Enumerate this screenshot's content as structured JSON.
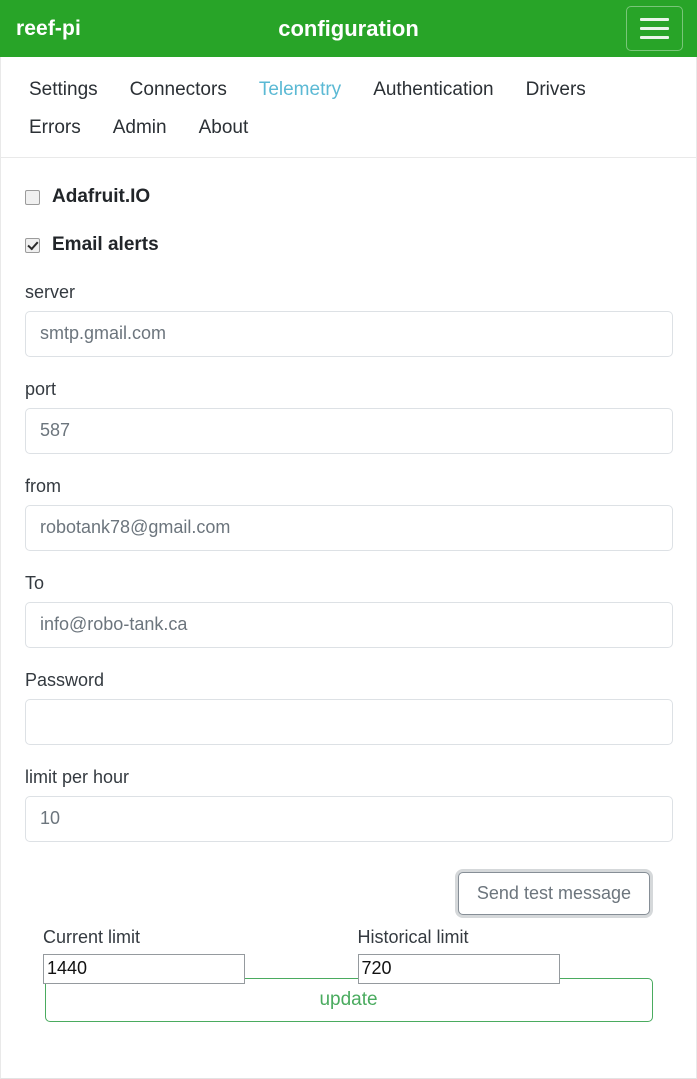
{
  "header": {
    "brand": "reef-pi",
    "title": "configuration",
    "menu_icon": "hamburger-menu-icon",
    "background_color": "#28a428"
  },
  "nav": {
    "active_color": "#5bb9d4",
    "tabs": [
      {
        "label": "Settings",
        "active": false
      },
      {
        "label": "Connectors",
        "active": false
      },
      {
        "label": "Telemetry",
        "active": true
      },
      {
        "label": "Authentication",
        "active": false
      },
      {
        "label": "Drivers",
        "active": false
      },
      {
        "label": "Errors",
        "active": false
      },
      {
        "label": "Admin",
        "active": false
      },
      {
        "label": "About",
        "active": false
      }
    ]
  },
  "toggles": [
    {
      "label": "Adafruit.IO",
      "checked": false
    },
    {
      "label": "Email alerts",
      "checked": true
    }
  ],
  "fields": [
    {
      "label": "server",
      "value": "smtp.gmail.com"
    },
    {
      "label": "port",
      "value": "587"
    },
    {
      "label": "from",
      "value": "robotank78@gmail.com"
    },
    {
      "label": "To",
      "value": "info@robo-tank.ca"
    },
    {
      "label": "Password",
      "value": ""
    },
    {
      "label": "limit per hour",
      "value": "10"
    }
  ],
  "actions": {
    "send_test_label": "Send test message",
    "update_label": "update",
    "update_color": "#4aab5f"
  },
  "limits": [
    {
      "label": "Current limit",
      "value": "1440"
    },
    {
      "label": "Historical limit",
      "value": "720"
    }
  ]
}
